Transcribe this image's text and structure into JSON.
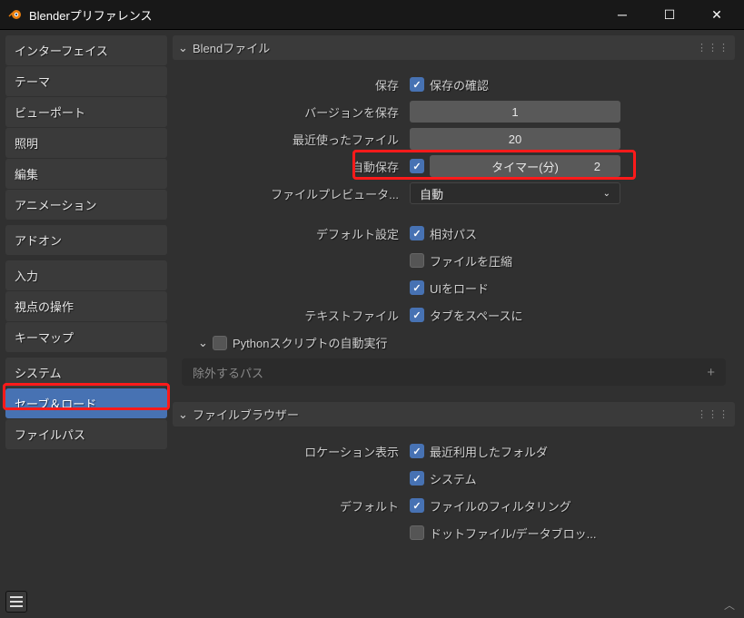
{
  "window": {
    "title": "Blenderプリファレンス"
  },
  "sidebar": {
    "groups": [
      {
        "items": [
          {
            "label": "インターフェイス"
          },
          {
            "label": "テーマ"
          },
          {
            "label": "ビューポート"
          },
          {
            "label": "照明"
          },
          {
            "label": "編集"
          },
          {
            "label": "アニメーション"
          }
        ]
      },
      {
        "items": [
          {
            "label": "アドオン"
          }
        ]
      },
      {
        "items": [
          {
            "label": "入力"
          },
          {
            "label": "視点の操作"
          },
          {
            "label": "キーマップ"
          }
        ]
      },
      {
        "items": [
          {
            "label": "システム"
          },
          {
            "label": "セーブ＆ロード",
            "active": true
          },
          {
            "label": "ファイルパス"
          }
        ]
      }
    ]
  },
  "panels": {
    "blend": {
      "title": "Blendファイル",
      "save": {
        "label": "保存",
        "confirm": "保存の確認"
      },
      "versions": {
        "label": "バージョンを保存",
        "value": "1"
      },
      "recent": {
        "label": "最近使ったファイル",
        "value": "20"
      },
      "autosave": {
        "label": "自動保存",
        "timer_label": "タイマー(分)",
        "timer_value": "2"
      },
      "preview": {
        "label": "ファイルプレビュータ...",
        "value": "自動"
      },
      "defaults": {
        "label": "デフォルト設定",
        "relative": "相対パス",
        "compress": "ファイルを圧縮",
        "loadui": "UIをロード"
      },
      "text": {
        "label": "テキストファイル",
        "tabs": "タブをスペースに"
      },
      "python": {
        "title": "Pythonスクリプトの自動実行"
      },
      "exclude": {
        "placeholder": "除外するパス"
      }
    },
    "browser": {
      "title": "ファイルブラウザー",
      "location": {
        "label": "ロケーション表示",
        "recent": "最近利用したフォルダ",
        "system": "システム"
      },
      "default": {
        "label": "デフォルト",
        "filter": "ファイルのフィルタリング",
        "dotfiles": "ドットファイル/データブロッ..."
      }
    }
  }
}
